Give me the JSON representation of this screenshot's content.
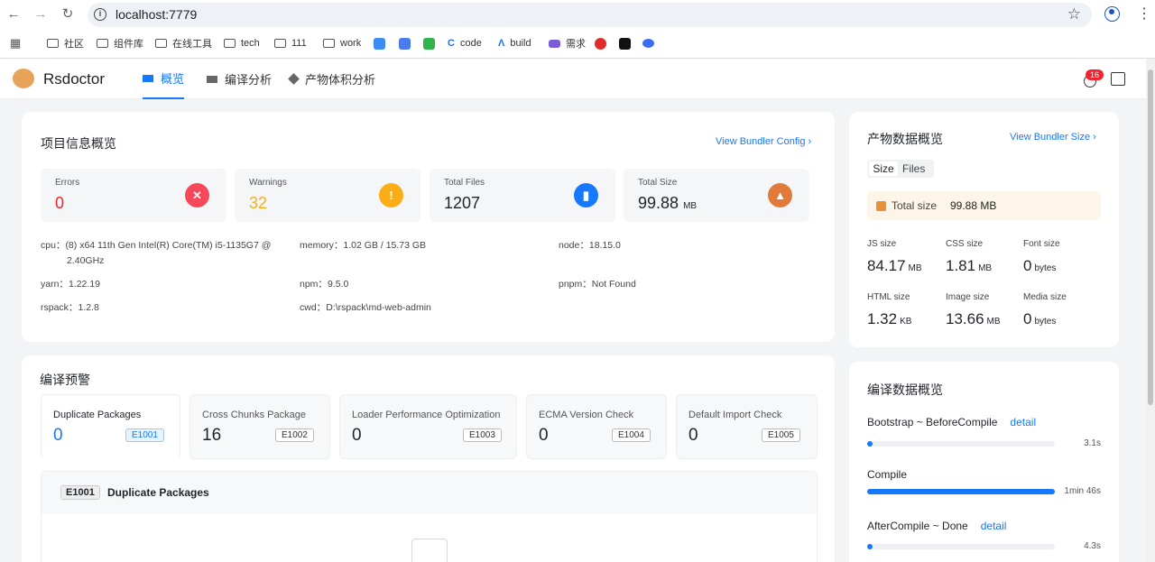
{
  "browser": {
    "url": "localhost:7779",
    "bookmarks": [
      "社区",
      "组件库",
      "在线工具",
      "tech",
      "111",
      "work",
      "code",
      "build",
      "需求"
    ]
  },
  "app": {
    "name": "Rsdoctor",
    "tabs": [
      "概览",
      "编译分析",
      "产物体积分析"
    ],
    "notification_count": "16"
  },
  "project": {
    "title": "项目信息概览",
    "link": "View Bundler Config",
    "stats": [
      {
        "label": "Errors",
        "value": "0",
        "color": "#f5222d"
      },
      {
        "label": "Warnings",
        "value": "32",
        "color": "#faad14"
      },
      {
        "label": "Total Files",
        "value": "1207",
        "color": "#1677ff"
      },
      {
        "label": "Total Size",
        "value": "99.88",
        "unit": "MB",
        "color": "#e07b39"
      }
    ],
    "env": {
      "cpu_label": "cpu：",
      "cpu": "(8) x64 11th Gen Intel(R) Core(TM) i5-1135G7 @",
      "cpu2": "2.40GHz",
      "memory_label": "memory：",
      "memory": "1.02 GB / 15.73 GB",
      "node_label": "node：",
      "node": "18.15.0",
      "yarn_label": "yarn：",
      "yarn": "1.22.19",
      "npm_label": "npm：",
      "npm": "9.5.0",
      "pnpm_label": "pnpm：",
      "pnpm": "Not Found",
      "rspack_label": "rspack：",
      "rspack": "1.2.8",
      "cwd_label": "cwd：",
      "cwd": "D:\\rspack\\md-web-admin"
    }
  },
  "bundle": {
    "title": "产物数据概览",
    "link": "View Bundler Size",
    "toggle": [
      "Size",
      "Files"
    ],
    "total_label": "Total size",
    "total_value": "99.88 MB",
    "sizes": [
      {
        "label": "JS size",
        "value": "84.17",
        "unit": "MB"
      },
      {
        "label": "CSS size",
        "value": "1.81",
        "unit": "MB"
      },
      {
        "label": "Font size",
        "value": "0",
        "unit": "bytes"
      },
      {
        "label": "HTML size",
        "value": "1.32",
        "unit": "KB"
      },
      {
        "label": "Image size",
        "value": "13.66",
        "unit": "MB"
      },
      {
        "label": "Media size",
        "value": "0",
        "unit": "bytes"
      }
    ]
  },
  "warnings": {
    "title": "编译预警",
    "tabs": [
      {
        "name": "Duplicate Packages",
        "count": "0",
        "code": "E1001"
      },
      {
        "name": "Cross Chunks Package",
        "count": "16",
        "code": "E1002"
      },
      {
        "name": "Loader Performance Optimization",
        "count": "0",
        "code": "E1003"
      },
      {
        "name": "ECMA Version Check",
        "count": "0",
        "code": "E1004"
      },
      {
        "name": "Default Import Check",
        "count": "0",
        "code": "E1005"
      }
    ],
    "detail_code": "E1001",
    "detail_title": "Duplicate Packages"
  },
  "compile": {
    "title": "编译数据概览",
    "detail_label": "detail",
    "phases": [
      {
        "name": "Bootstrap ~ BeforeCompile",
        "time": "3.1s",
        "fraction": 0.02,
        "detail": true
      },
      {
        "name": "Compile",
        "time": "1min 46s",
        "fraction": 1.0,
        "detail": false
      },
      {
        "name": "AfterCompile ~ Done",
        "time": "4.3s",
        "fraction": 0.02,
        "detail": true
      }
    ]
  }
}
